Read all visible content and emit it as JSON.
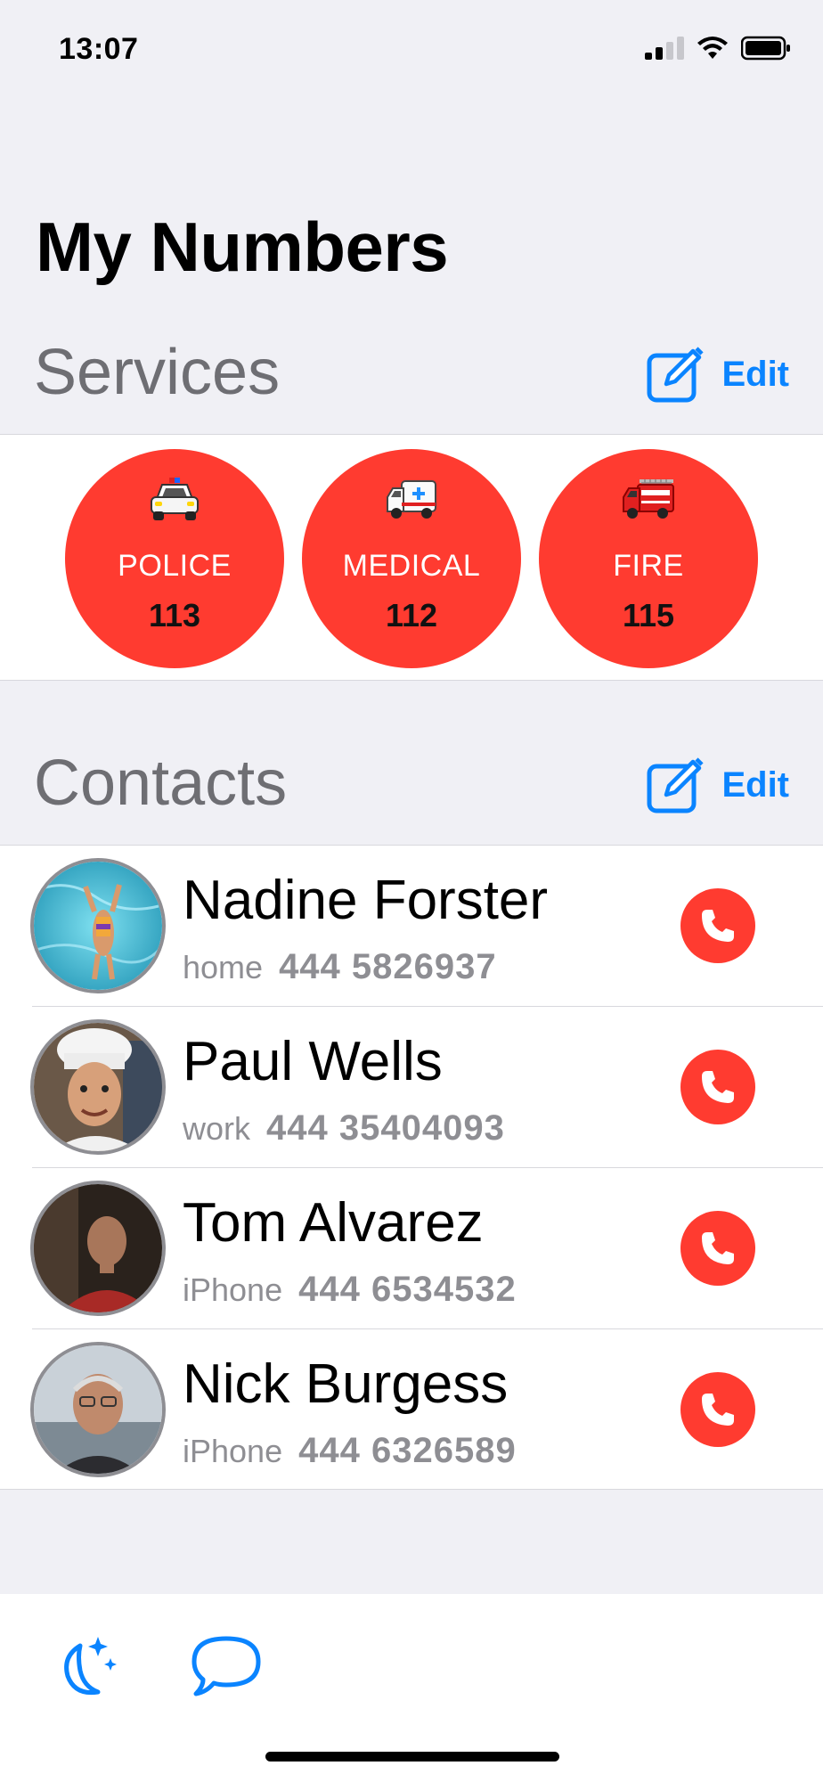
{
  "status_bar": {
    "time": "13:07"
  },
  "page_title": "My Numbers",
  "services_section": {
    "title": "Services",
    "edit_label": "Edit",
    "items": [
      {
        "name": "POLICE",
        "number": "113",
        "icon": "police-car-icon"
      },
      {
        "name": "MEDICAL",
        "number": "112",
        "icon": "ambulance-icon"
      },
      {
        "name": "FIRE",
        "number": "115",
        "icon": "fire-engine-icon"
      }
    ]
  },
  "contacts_section": {
    "title": "Contacts",
    "edit_label": "Edit",
    "items": [
      {
        "name": "Nadine Forster",
        "type": "home",
        "number": "444 5826937"
      },
      {
        "name": "Paul Wells",
        "type": "work",
        "number": "444 35404093"
      },
      {
        "name": "Tom Alvarez",
        "type": "iPhone",
        "number": "444 6534532"
      },
      {
        "name": "Nick Burgess",
        "type": "iPhone",
        "number": "444 6326589"
      }
    ]
  },
  "tab_bar": {
    "icons": [
      "moon-stars-icon",
      "speech-bubble-icon"
    ]
  },
  "colors": {
    "accent": "#0a84ff",
    "emergency": "#ff3b30",
    "background": "#f0f0f5"
  }
}
